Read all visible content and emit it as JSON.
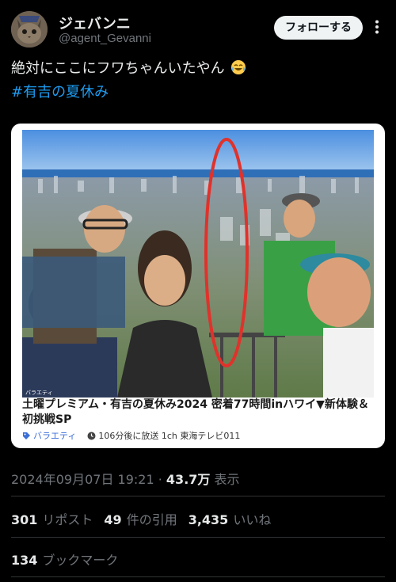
{
  "author": {
    "name": "ジェバンニ",
    "handle": "@agent_Gevanni",
    "follow_label": "フォローする"
  },
  "tweet": {
    "text": "絶対にここにフワちゃんいたやん",
    "emoji": "laughing-tears-emoji",
    "hashtag": "#有吉の夏休み"
  },
  "card": {
    "watermark": "バラエティ",
    "title": "土曜プレミアム・有吉の夏休み2024 密着77時間inハワイ▼新体験＆初挑戦SP",
    "tag_label": "バラエティ",
    "schedule": "106分後に放送 1ch 東海テレビ011"
  },
  "meta": {
    "datetime": "2024年09月07日 19:21",
    "separator": "·",
    "views": "43.7万",
    "views_label": "表示"
  },
  "stats": {
    "reposts": "301",
    "reposts_label": "リポスト",
    "quotes": "49",
    "quotes_label": "件の引用",
    "likes": "3,435",
    "likes_label": "いいね",
    "bookmarks": "134",
    "bookmarks_label": "ブックマーク"
  },
  "colors": {
    "background": "#000000",
    "link": "#1d9bf0",
    "muted": "#71767b",
    "highlight_circle": "#e0322b"
  }
}
